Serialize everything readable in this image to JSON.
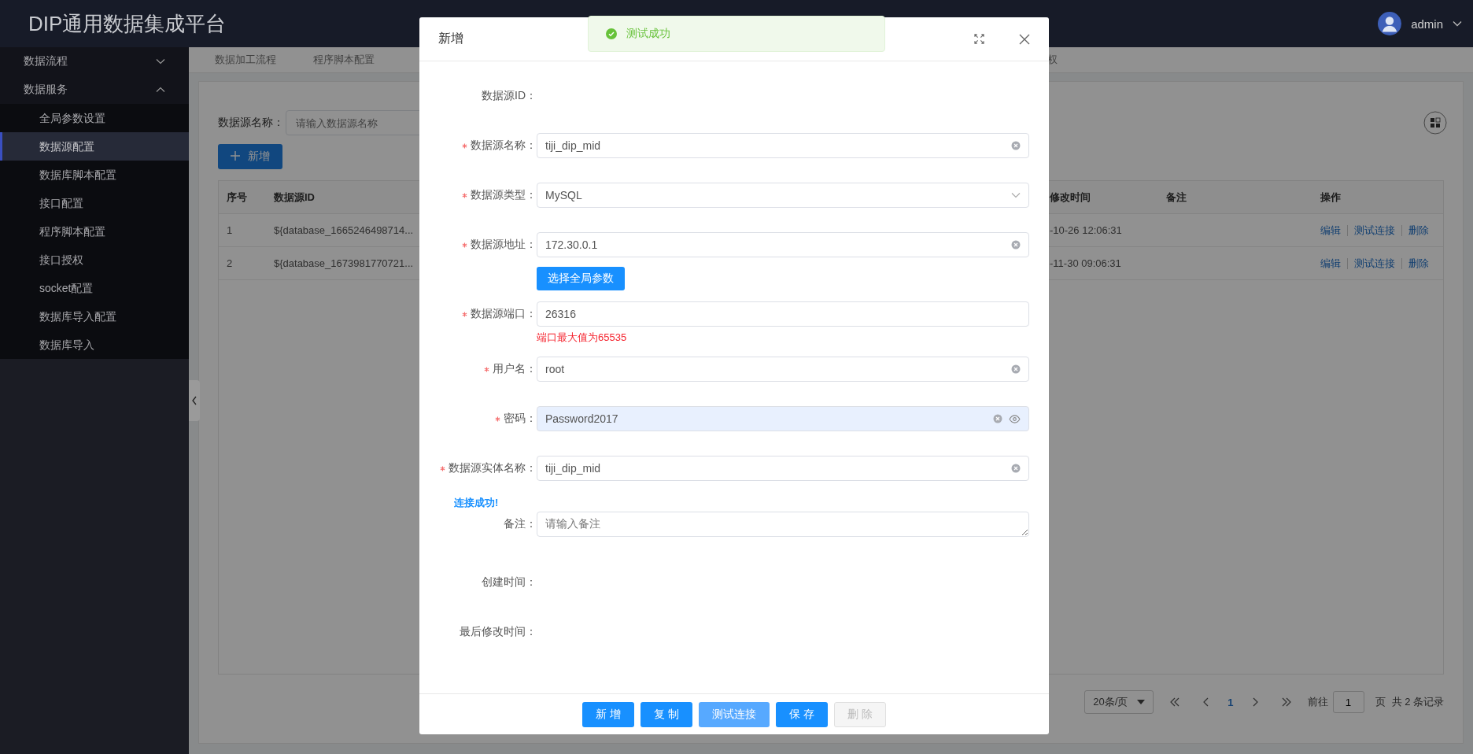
{
  "app": {
    "title": "DIP通用数据集成平台"
  },
  "user": {
    "name": "admin"
  },
  "sidebar": [
    {
      "label": "数据流程",
      "expanded": false
    },
    {
      "label": "数据服务",
      "expanded": true,
      "children": [
        {
          "label": "全局参数设置",
          "selected": false
        },
        {
          "label": "数据源配置",
          "selected": true
        },
        {
          "label": "数据库脚本配置",
          "selected": false
        },
        {
          "label": "接口配置",
          "selected": false
        },
        {
          "label": "程序脚本配置",
          "selected": false
        },
        {
          "label": "接口授权",
          "selected": false
        },
        {
          "label": "socket配置",
          "selected": false
        },
        {
          "label": "数据库导入配置",
          "selected": false
        },
        {
          "label": "数据库导入",
          "selected": false
        }
      ]
    }
  ],
  "tabs": [
    {
      "label": "数据加工流程"
    },
    {
      "label": "程序脚本配置"
    },
    {
      "label": "权"
    }
  ],
  "search": {
    "label": "数据源名称：",
    "placeholder": "请输入数据源名称"
  },
  "add_button": "新增",
  "table": {
    "columns": [
      "序号",
      "数据源ID",
      "修改时间",
      "备注",
      "操作"
    ],
    "rows": [
      {
        "index": "1",
        "id": "${database_1665246498714...",
        "modified": "-10-26 12:06:31",
        "actions": [
          "编辑",
          "测试连接",
          "删除"
        ]
      },
      {
        "index": "2",
        "id": "${database_1673981770721...",
        "modified": "-11-30 09:06:31",
        "actions": [
          "编辑",
          "测试连接",
          "删除"
        ]
      }
    ]
  },
  "pagination": {
    "page_size": "20条/页",
    "pages": [
      {
        "label": "1",
        "selected": true
      }
    ],
    "goto_label": "前往",
    "goto_value": "1",
    "page_suffix": "页",
    "total": "共 2 条记录"
  },
  "toast": {
    "kind": "success",
    "text": "测试成功"
  },
  "dialog": {
    "title": "新增",
    "fields": [
      {
        "kind": "static",
        "label": "数据源ID：",
        "required": false
      },
      {
        "kind": "input",
        "label": "数据源名称：",
        "required": true,
        "value": "tiji_dip_mid",
        "clearable": true
      },
      {
        "kind": "select",
        "label": "数据源类型：",
        "required": true,
        "value": "MySQL",
        "clearable": false
      },
      {
        "kind": "input",
        "label": "数据源地址：",
        "required": true,
        "value": "172.30.0.1",
        "clearable": true,
        "button": "选择全局参数"
      },
      {
        "kind": "input",
        "label": "数据源端口：",
        "required": true,
        "value": "26316",
        "clearable": false,
        "error": "端口最大值为65535"
      },
      {
        "kind": "input",
        "label": "用户名：",
        "required": true,
        "value": "root",
        "clearable": true
      },
      {
        "kind": "password",
        "label": "密码：",
        "required": true,
        "value": "Password2017",
        "clearable": true,
        "autofilled": true
      },
      {
        "kind": "input",
        "label": "数据源实体名称：",
        "required": true,
        "value": "tiji_dip_mid",
        "clearable": true
      },
      {
        "kind": "textarea",
        "label": "备注：",
        "required": false,
        "placeholder": "请输入备注",
        "note": "连接成功!"
      },
      {
        "kind": "static",
        "label": "创建时间：",
        "required": false
      },
      {
        "kind": "static",
        "label": "最后修改时间：",
        "required": false
      }
    ],
    "buttons": [
      {
        "label": "新 增",
        "hovered": false,
        "disabled": false
      },
      {
        "label": "复 制",
        "hovered": false,
        "disabled": false
      },
      {
        "label": "测试连接",
        "hovered": true,
        "disabled": false
      },
      {
        "label": "保 存",
        "hovered": false,
        "disabled": false
      },
      {
        "label": "删 除",
        "hovered": false,
        "disabled": true
      }
    ]
  }
}
